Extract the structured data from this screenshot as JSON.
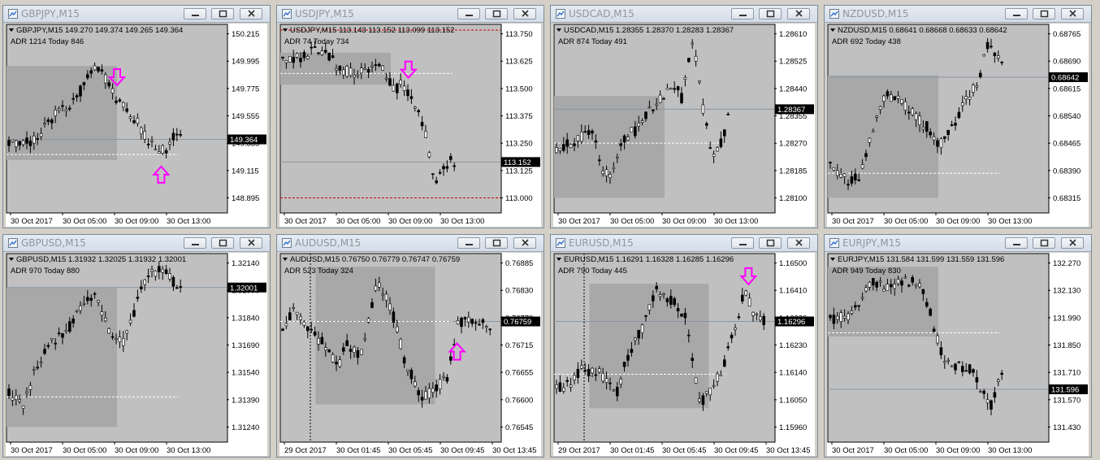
{
  "colors": {
    "plot_bg": "#c0c0c0",
    "session_box": "#a8a8a8",
    "candle_body": "#000000",
    "candle_up_accent": "#00c000",
    "arrow": "#ff00ff",
    "price_tag_bg": "#000000",
    "level_line": "#8896a4",
    "range_line": "#ffffff",
    "limit_line": "#d00000"
  },
  "windows": [
    {
      "title": "GBPJPY,M15",
      "header": "GBPJPY,M15  149.270 149.374 149.265 149.364",
      "adr": "ADR 1214  Today 846",
      "price_tag": "149.364",
      "price_labels": [
        "150.215",
        "149.995",
        "149.775",
        "149.555",
        "149.335",
        "149.115",
        "148.895"
      ],
      "time_labels": [
        "30 Oct 2017",
        "30 Oct 05:00",
        "30 Oct 09:00",
        "30 Oct 13:00"
      ],
      "arrows": [
        "down",
        "up"
      ]
    },
    {
      "title": "USDJPY,M15",
      "header": "USDJPY,M15  113.143 113.152 113.099 113.152",
      "adr": "ADR 74",
      "adr_after": "Today 734",
      "price_tag": "113.152",
      "price_labels": [
        "113.750",
        "113.625",
        "113.500",
        "113.375",
        "113.250",
        "113.125",
        "113.000"
      ],
      "time_labels": [
        "30 Oct 2017",
        "30 Oct 05:00",
        "30 Oct 09:00",
        "30 Oct 13:00"
      ],
      "arrows": [
        "down"
      ]
    },
    {
      "title": "USDCAD,M15",
      "header": "USDCAD,M15  1.28355 1.28370 1.28283 1.28367",
      "adr": "ADR 874  Today 491",
      "price_tag": "1.28367",
      "price_labels": [
        "1.28610",
        "1.28525",
        "1.28440",
        "1.28355",
        "1.28270",
        "1.28185",
        "1.28100"
      ],
      "time_labels": [
        "30 Oct 2017",
        "30 Oct 05:00",
        "30 Oct 09:00",
        "30 Oct 13:00"
      ],
      "arrows": []
    },
    {
      "title": "NZDUSD,M15",
      "header": "NZDUSD,M15  0.68641 0.68668 0.68633 0.68642",
      "adr": "ADR 692  Today 438",
      "price_tag": "0.68642",
      "price_labels": [
        "0.68765",
        "0.68690",
        "0.68615",
        "0.68540",
        "0.68465",
        "0.68390",
        "0.68315"
      ],
      "time_labels": [
        "30 Oct 2017",
        "30 Oct 05:00",
        "30 Oct 09:00",
        "30 Oct 13:00"
      ],
      "arrows": []
    },
    {
      "title": "GBPUSD,M15",
      "header": "GBPUSD,M15  1.31932 1.32025 1.31932 1.32001",
      "adr": "ADR 970  Today 880",
      "price_tag": "1.32001",
      "price_labels": [
        "1.32140",
        "1.31990",
        "1.31840",
        "1.31690",
        "1.31540",
        "1.31390",
        "1.31240"
      ],
      "time_labels": [
        "30 Oct 2017",
        "30 Oct 05:00",
        "30 Oct 09:00",
        "30 Oct 13:00"
      ],
      "arrows": []
    },
    {
      "title": "AUDUSD,M15",
      "header": "AUDUSD,M15  0.76750 0.76779 0.76747 0.76759",
      "adr": "ADR 523  Today 324",
      "price_tag": "0.76759",
      "price_labels": [
        "0.76885",
        "0.76830",
        "0.76770",
        "0.76715",
        "0.76655",
        "0.76600",
        "0.76545"
      ],
      "time_labels": [
        "29 Oct 2017",
        "30 Oct 01:45",
        "30 Oct 05:45",
        "30 Oct 09:45",
        "30 Oct 13:45"
      ],
      "arrows": [
        "up"
      ]
    },
    {
      "title": "EURUSD,M15",
      "header": "EURUSD,M15  1.16291 1.16328 1.16285 1.16296",
      "adr": "ADR 790  Today 445",
      "price_tag": "1.16296",
      "price_labels": [
        "1.16500",
        "1.16410",
        "1.16320",
        "1.16230",
        "1.16140",
        "1.16050",
        "1.15960"
      ],
      "time_labels": [
        "29 Oct 2017",
        "30 Oct 01:45",
        "30 Oct 05:45",
        "30 Oct 09:45",
        "30 Oct 13:45"
      ],
      "arrows": [
        "down"
      ]
    },
    {
      "title": "EURJPY,M15",
      "header": "EURJPY,M15  131.584 131.599 131.559 131.596",
      "adr": "ADR 949  Today 830",
      "price_tag": "131.596",
      "price_labels": [
        "132.270",
        "132.130",
        "131.990",
        "131.850",
        "131.710",
        "131.570",
        "131.430"
      ],
      "time_labels": [
        "30 Oct 2017",
        "30 Oct 05:00",
        "30 Oct 09:00",
        "30 Oct 13:00"
      ],
      "arrows": []
    }
  ]
}
